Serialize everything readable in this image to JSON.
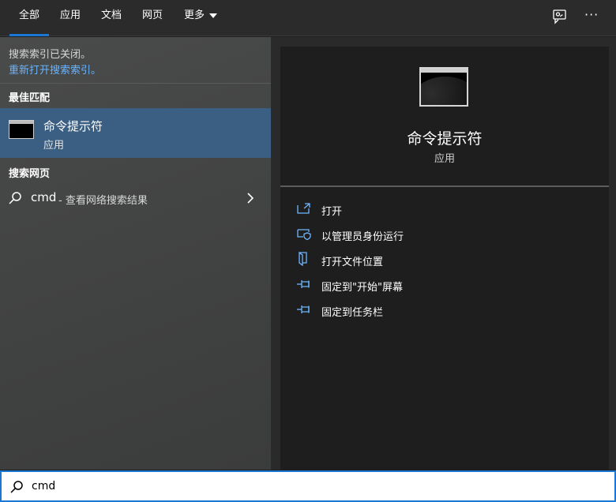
{
  "tabs": [
    {
      "label": "全部"
    },
    {
      "label": "应用"
    },
    {
      "label": "文档"
    },
    {
      "label": "网页"
    },
    {
      "label": "更多"
    }
  ],
  "top_icons": [
    "feedback-icon",
    "more-options-icon"
  ],
  "top_more_glyph": "···",
  "index_notice": {
    "message": "搜索索引已关闭。",
    "link": "重新打开搜索索引。"
  },
  "best_match": {
    "section_title": "最佳匹配",
    "name": "命令提示符",
    "type": "应用"
  },
  "web": {
    "section_title": "搜索网页",
    "query": "cmd",
    "desc": " - 查看网络搜索结果"
  },
  "detail": {
    "name": "命令提示符",
    "type": "应用",
    "actions": [
      {
        "label": "打开",
        "icon": "open-icon"
      },
      {
        "label": "以管理员身份运行",
        "icon": "shield-icon"
      },
      {
        "label": "打开文件位置",
        "icon": "file-location-icon"
      },
      {
        "label": "固定到\"开始\"屏幕",
        "icon": "pin-icon"
      },
      {
        "label": "固定到任务栏",
        "icon": "pin-icon"
      }
    ]
  },
  "search": {
    "value": "cmd"
  },
  "colors": {
    "accent": "#1a78d4",
    "selected_bg": "#3a5f82",
    "link": "#69b4ff",
    "action_icon": "#6eb6ff"
  }
}
